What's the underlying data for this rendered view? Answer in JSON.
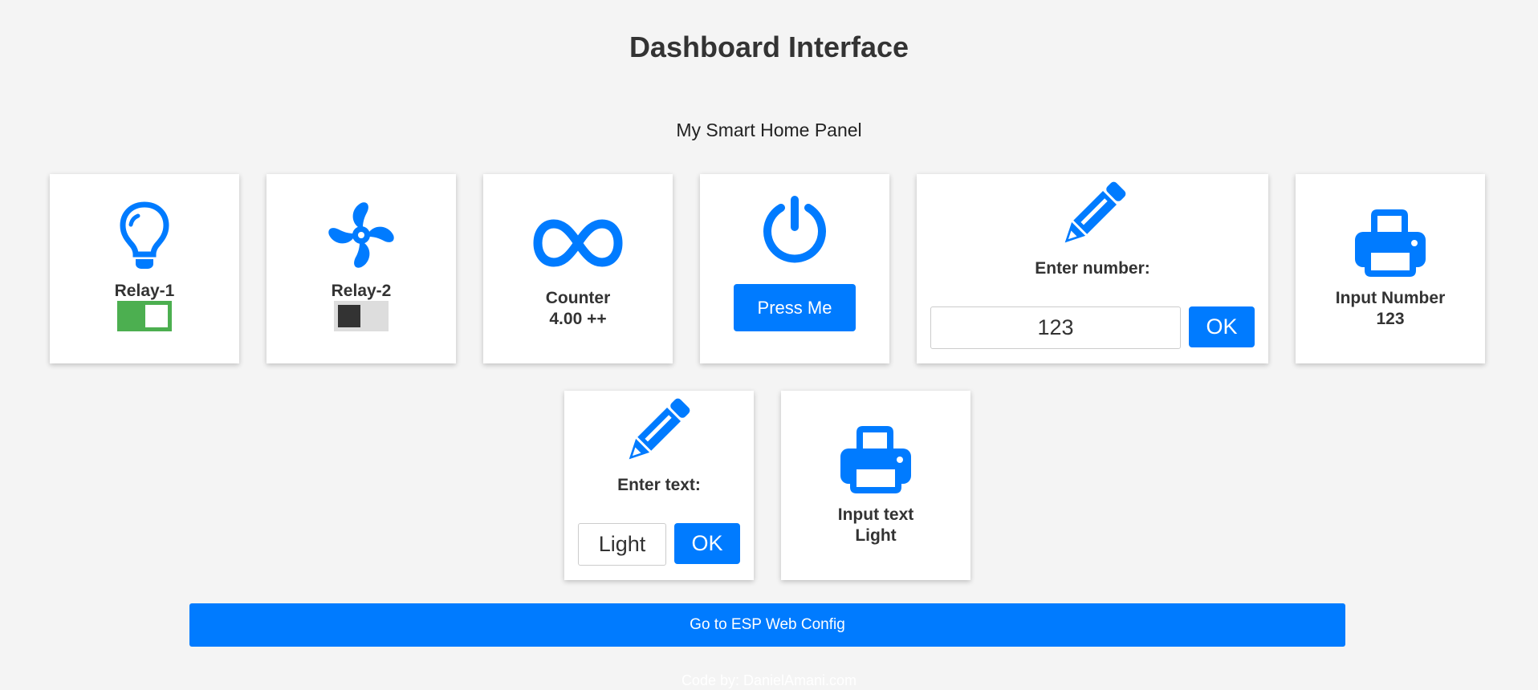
{
  "header": {
    "title": "Dashboard Interface",
    "subtitle": "My Smart Home Panel"
  },
  "cards": {
    "relay1": {
      "icon": "lightbulb-icon",
      "label": "Relay-1",
      "state": "on"
    },
    "relay2": {
      "icon": "fan-icon",
      "label": "Relay-2",
      "state": "off"
    },
    "counter": {
      "icon": "infinity-icon",
      "label": "Counter",
      "value": "4.00 ++"
    },
    "power": {
      "icon": "power-icon",
      "button_label": "Press Me"
    },
    "enter_number": {
      "icon": "pencil-icon",
      "label": "Enter number:",
      "input_value": "123",
      "ok_label": "OK"
    },
    "input_number": {
      "icon": "printer-icon",
      "label": "Input Number",
      "value": "123"
    },
    "enter_text": {
      "icon": "pencil-icon",
      "label": "Enter text:",
      "input_value": "Light",
      "ok_label": "OK"
    },
    "input_text": {
      "icon": "printer-icon",
      "label": "Input text",
      "value": "Light"
    }
  },
  "config_button": {
    "label": "Go to ESP Web Config"
  },
  "footer": {
    "text": "Code by: DanielAmani.com"
  },
  "colors": {
    "accent": "#007bff",
    "toggle_on": "#4caf50",
    "background": "#f4f4f4"
  }
}
